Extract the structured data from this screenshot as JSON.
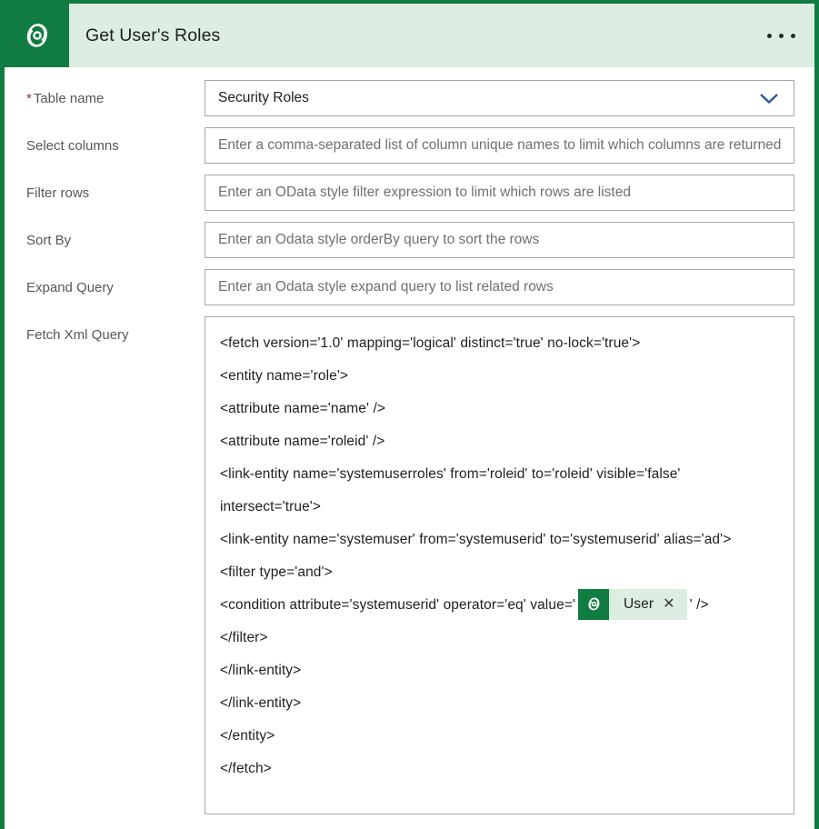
{
  "header": {
    "title": "Get User's Roles",
    "icon": "dataverse-logo-icon",
    "menu_icon": "ellipsis-icon",
    "background": "#dceee1",
    "accent": "#107c41"
  },
  "form": {
    "fields": [
      {
        "label": "Table name",
        "required": true,
        "required_marker": "*",
        "type": "combobox",
        "value": "Security Roles",
        "chevron_icon": "chevron-down-icon",
        "chevron_color": "#2b579a"
      },
      {
        "label": "Select columns",
        "required": false,
        "type": "text",
        "value": "",
        "placeholder": "Enter a comma-separated list of column unique names to limit which columns are returned"
      },
      {
        "label": "Filter rows",
        "required": false,
        "type": "text",
        "value": "",
        "placeholder": "Enter an OData style filter expression to limit which rows are listed"
      },
      {
        "label": "Sort By",
        "required": false,
        "type": "text",
        "value": "",
        "placeholder": "Enter an Odata style orderBy query to sort the rows"
      },
      {
        "label": "Expand Query",
        "required": false,
        "type": "text",
        "value": "",
        "placeholder": "Enter an Odata style expand query to list related rows"
      }
    ],
    "fetch_xml": {
      "label": "Fetch Xml Query",
      "required": false,
      "lines": [
        "<fetch version='1.0' mapping='logical' distinct='true' no-lock='true'>",
        "<entity name='role'>",
        "<attribute name='name' />",
        "<attribute name='roleid' />",
        "<link-entity name='systemuserroles' from='roleid' to='roleid' visible='false' intersect='true'>",
        "<link-entity name='systemuser' from='systemuserid' to='systemuserid' alias='ad'>",
        "<filter type='and'>"
      ],
      "condition_line": {
        "prefix": "<condition attribute='systemuserid' operator='eq' value='",
        "token": {
          "label": "User",
          "icon": "dataverse-logo-icon",
          "close_icon": "close-icon",
          "background": "#dceee1",
          "icon_background": "#107c41"
        },
        "suffix": "' />"
      },
      "closing_lines": [
        "</filter>",
        "</link-entity>",
        "</link-entity>",
        "</entity>",
        "</fetch>"
      ]
    }
  }
}
